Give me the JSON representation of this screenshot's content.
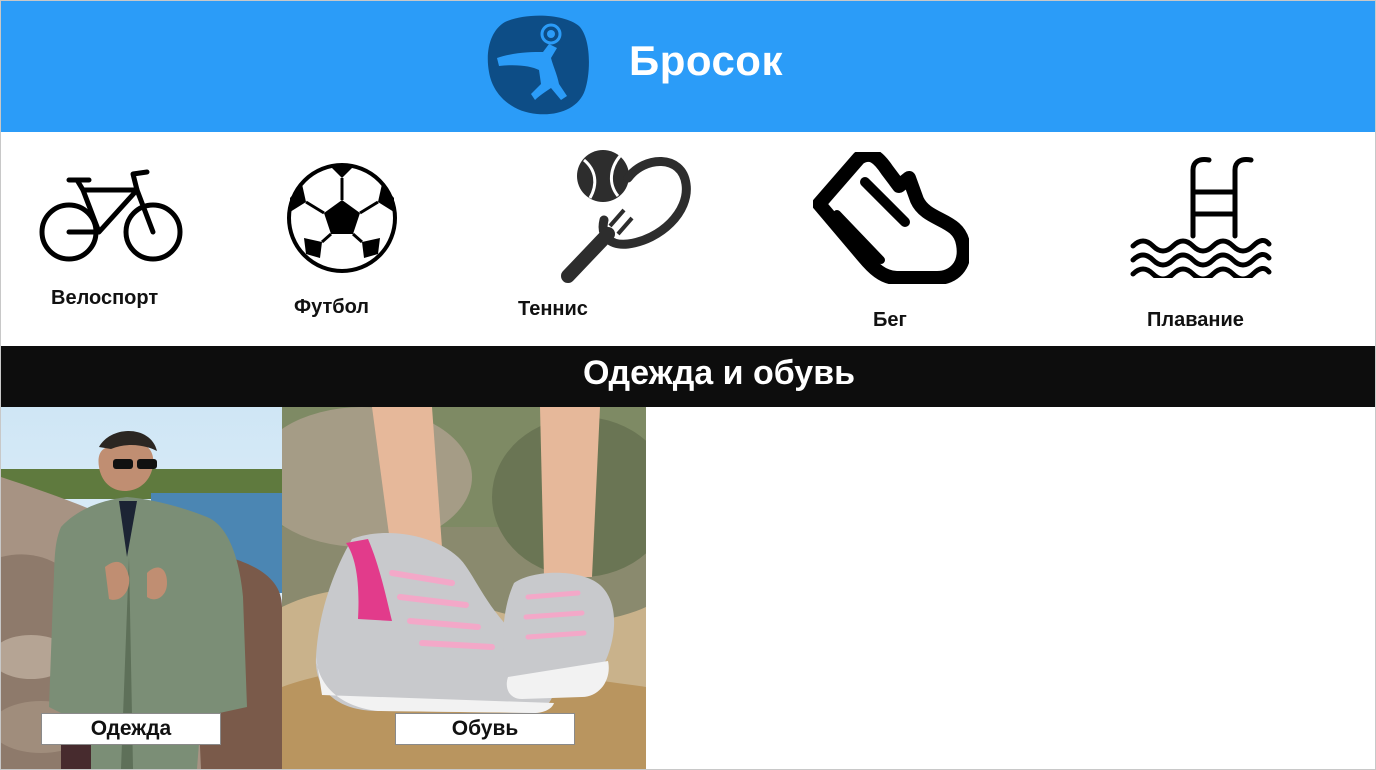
{
  "header": {
    "title": "Бросок",
    "logo_icon": "handball-player-logo",
    "background_color": "#2b9cf8"
  },
  "sports": [
    {
      "label": "Велоспорт",
      "icon": "bicycle-icon"
    },
    {
      "label": "Футбол",
      "icon": "soccer-ball-icon"
    },
    {
      "label": "Теннис",
      "icon": "tennis-racket-icon"
    },
    {
      "label": "Бег",
      "icon": "running-shoe-icon"
    },
    {
      "label": "Плавание",
      "icon": "swimming-pool-icon"
    }
  ],
  "section": {
    "title": "Одежда и обувь"
  },
  "tiles": [
    {
      "label": "Одежда",
      "image": "man-in-green-jacket-photo"
    },
    {
      "label": "Обувь",
      "image": "pink-gray-sneakers-photo"
    }
  ]
}
